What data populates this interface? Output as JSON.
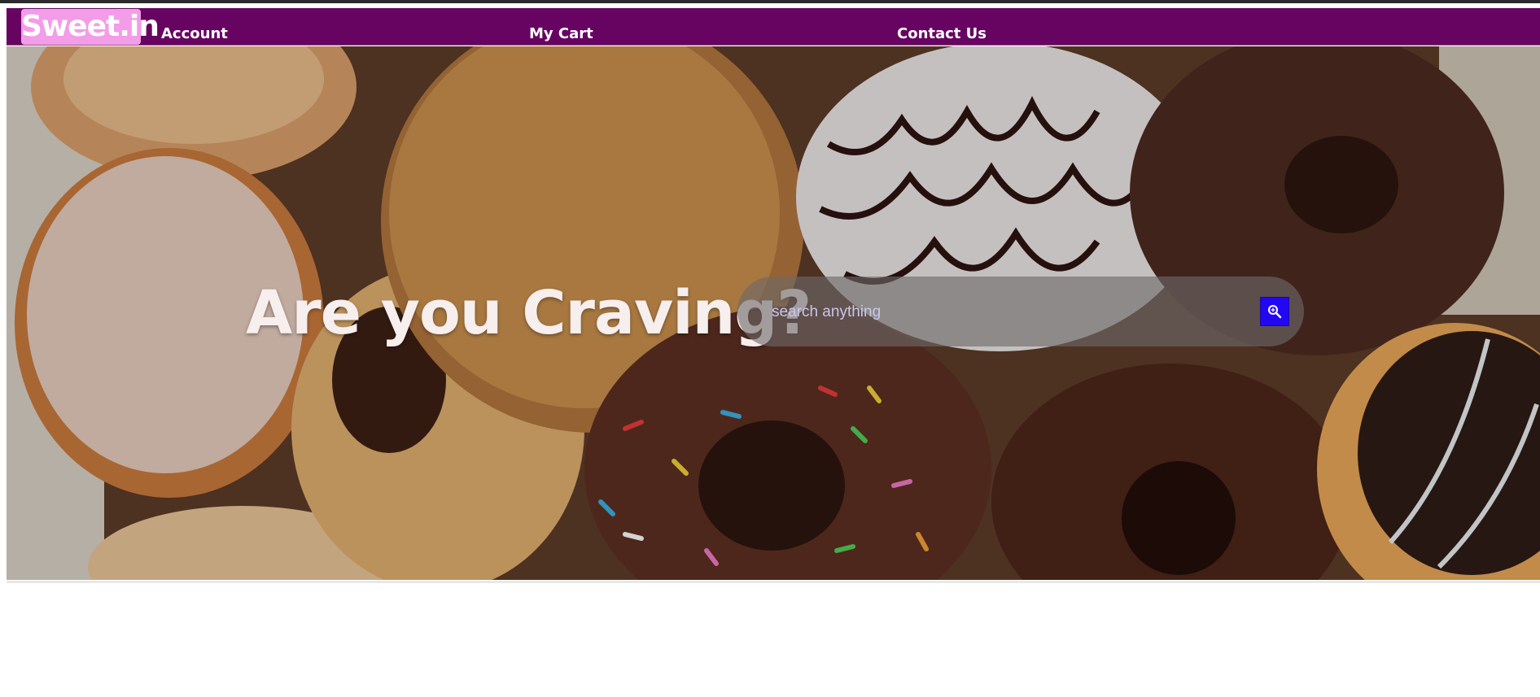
{
  "brand": {
    "logo_text": "Sweet.in",
    "accent_color": "#670461",
    "logo_bg": "#f39ce8"
  },
  "nav": {
    "items": [
      {
        "label": "Account"
      },
      {
        "label": "My Cart"
      },
      {
        "label": "Contact Us"
      }
    ]
  },
  "hero": {
    "headline": "Are you Craving?",
    "background": "donuts-photo"
  },
  "search": {
    "placeholder": "search anything",
    "value": "",
    "button_icon": "search-zoom-icon",
    "button_color": "#2306f2"
  }
}
